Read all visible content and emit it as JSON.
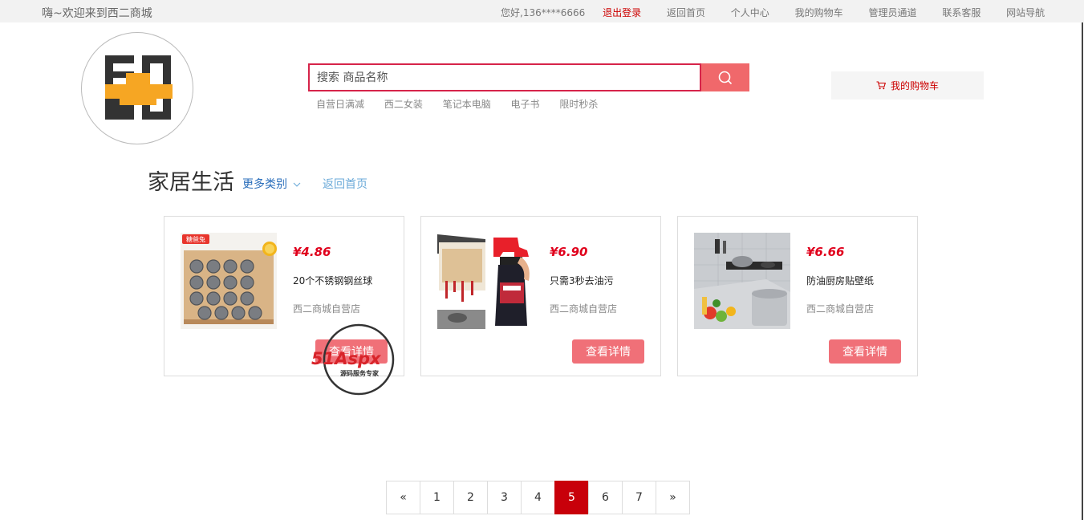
{
  "topbar": {
    "welcome": "嗨~欢迎来到西二商城",
    "greeting": "您好,136****6666",
    "logout": "退出登录",
    "nav": [
      "返回首页",
      "个人中心",
      "我的购物车",
      "管理员通道",
      "联系客服",
      "网站导航"
    ]
  },
  "search": {
    "placeholder": "搜索 商品名称",
    "hot": [
      "自营日满减",
      "西二女装",
      "笔记本电脑",
      "电子书",
      "限时秒杀"
    ]
  },
  "cart": {
    "label": "我的购物车"
  },
  "category": {
    "title": "家居生活",
    "more": "更多类别",
    "back": "返回首页"
  },
  "products": [
    {
      "price": "¥4.86",
      "name": "20个不锈钢钢丝球",
      "shop": "西二商城自营店",
      "detail": "查看详情",
      "tag": "糖爸兔"
    },
    {
      "price": "¥6.90",
      "name": "只需3秒去油污",
      "shop": "西二商城自营店",
      "detail": "查看详情"
    },
    {
      "price": "¥6.66",
      "name": "防油厨房贴壁纸",
      "shop": "西二商城自营店",
      "detail": "查看详情"
    }
  ],
  "pagination": {
    "prev": "«",
    "pages": [
      "1",
      "2",
      "3",
      "4",
      "5",
      "6",
      "7"
    ],
    "current": "5",
    "next": "»"
  },
  "watermark": {
    "brand": "51Aspx",
    "slogan": "源码服务专家"
  },
  "colors": {
    "accent": "#f0686b",
    "price": "#e0001c",
    "active_page": "#c8000a",
    "search_border": "#d6244a"
  }
}
